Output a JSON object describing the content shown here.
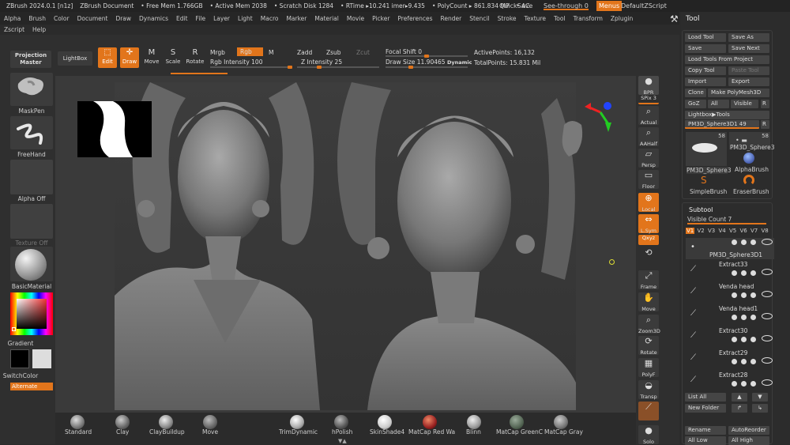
{
  "titlebar": {
    "app": "ZBrush 2024.0.1 [n1z]",
    "doc": "ZBrush Document",
    "free_mem": "• Free Mem 1.766GB",
    "active_mem": "• Active Mem 2038",
    "scratch": "• Scratch Disk 1284",
    "rtime": "• RTime ▸10.241 imer▸9.435",
    "polycount": "• PolyCount ▸ 861.834 MP",
    "ac": "• AC",
    "quicksave": "QuickSave",
    "seethrough": "See-through",
    "seethrough_val": "0",
    "menus": "Menus",
    "defaultscript": "DefaultZScript"
  },
  "menu": [
    "Alpha",
    "Brush",
    "Color",
    "Document",
    "Draw",
    "Dynamics",
    "Edit",
    "File",
    "Layer",
    "Light",
    "Macro",
    "Marker",
    "Material",
    "Movie",
    "Picker",
    "Preferences",
    "Render",
    "Stencil",
    "Stroke",
    "Texture",
    "Tool",
    "Transform",
    "Zplugin"
  ],
  "menu2": [
    "Zscript",
    "Help"
  ],
  "toolbar": {
    "projection_master": "Projection Master",
    "lightbox": "LightBox",
    "edit": "Edit",
    "draw": "Draw",
    "move": "Move",
    "scale": "Scale",
    "rotate": "Rotate",
    "mrgb": "Mrgb",
    "rgb": "Rgb",
    "m": "M",
    "rgb_intensity": "Rgb Intensity 100",
    "zadd": "Zadd",
    "zsub": "Zsub",
    "zcut": "Zcut",
    "z_intensity": "Z Intensity 25",
    "focal_shift": "Focal Shift 0",
    "draw_size": "Draw Size 11.90465",
    "dynamic": "Dynamic",
    "active_points": "ActivePoints: 16,132",
    "total_points": "TotalPoints: 15.831 Mil",
    "rgb_intensity_level": 1.0,
    "z_intensity_level": 0.25,
    "draw_size_level": 0.3
  },
  "leftpanel": {
    "maskpen": "MaskPen",
    "freehand": "FreeHand",
    "alpha_off": "Alpha Off",
    "texture_off": "Texture Off",
    "basic_material": "BasicMaterial",
    "gradient": "Gradient",
    "switch_color": "SwitchColor",
    "alternate": "Alternate"
  },
  "rightshelf": {
    "bpr": "BPR",
    "spix": "SPix 3",
    "actual": "Actual",
    "aahalf": "AAHalf",
    "persp": "Persp",
    "floor": "Floor",
    "local": "Local",
    "lsym": "L.Sym",
    "xyz": "Qxyz",
    "frame": "Frame",
    "move": "Move",
    "zoom3d": "Zoom3D",
    "rotate": "Rotate",
    "polyf": "PolyF",
    "transp": "Transp",
    "solo": "Solo"
  },
  "materials": [
    "Standard",
    "Clay",
    "ClayBuildup",
    "Move",
    "TrimDynamic",
    "hPolish",
    "SkinShade4",
    "MatCap Red Wa",
    "Blinn",
    "MatCap GreenC",
    "MatCap Gray"
  ],
  "tool": {
    "title": "Tool",
    "load_tool": "Load Tool",
    "save_as": "Save As",
    "save": "Save",
    "save_next": "Save Next",
    "load_from_project": "Load Tools From Project",
    "copy_tool": "Copy Tool",
    "paste_tool": "Paste Tool",
    "import": "Import",
    "export": "Export",
    "clone": "Clone",
    "make_polymesh": "Make PolyMesh3D",
    "goz": "GoZ",
    "all": "All",
    "visible": "Visible",
    "r": "R",
    "lightbox_tools": "Lightbox▶Tools",
    "current_tool": "PM3D_Sphere3D1",
    "current_count": "49",
    "thumb1_count": "58",
    "thumb2_count": "58",
    "thumb1": "PM3D_Sphere3",
    "thumb2": "PM3D_Sphere3",
    "thumb3": "PM3D_Sphere3",
    "alphabrush": "AlphaBrush",
    "simplebrush": "SimpleBrush",
    "eraserbrush": "EraserBrush"
  },
  "subtool": {
    "title": "Subtool",
    "visible_count": "Visible Count 7",
    "versions": [
      "V1",
      "V2",
      "V3",
      "V4",
      "V5",
      "V6",
      "V7",
      "V8"
    ],
    "items": [
      "PM3D_Sphere3D1",
      "Extract33",
      "Venda head",
      "Venda head1",
      "Extract30",
      "Extract29",
      "Extract28"
    ],
    "list_all": "List All",
    "new_folder": "New Folder",
    "rename": "Rename",
    "auto_reorder": "AutoReorder",
    "all_low": "All Low",
    "all_high": "All High"
  }
}
